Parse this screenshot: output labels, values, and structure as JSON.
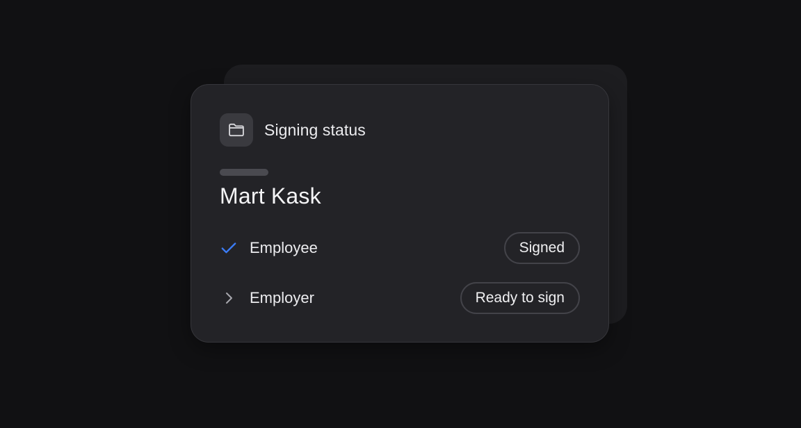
{
  "card": {
    "title": "Signing status",
    "folder_icon": "folder-icon",
    "person_name": "Mart Kask"
  },
  "signers": [
    {
      "role": "Employee",
      "status": "Signed",
      "icon": "check-icon",
      "icon_color": "#3b7cf6"
    },
    {
      "role": "Employer",
      "status": "Ready to sign",
      "icon": "chevron-right-icon",
      "icon_color": "#a8a8ae"
    }
  ],
  "colors": {
    "background": "#111113",
    "card": "#232327",
    "accent": "#3b7cf6"
  }
}
